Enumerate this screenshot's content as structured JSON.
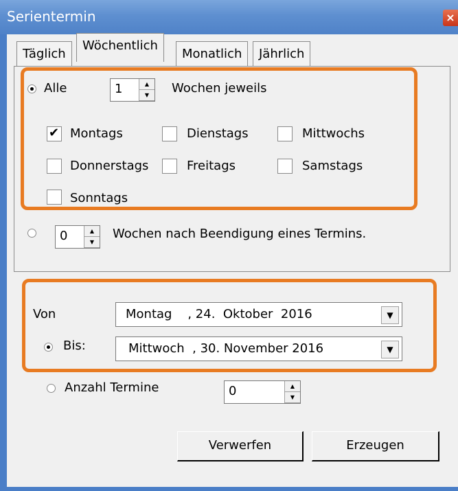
{
  "window": {
    "title": "Serientermin",
    "close_glyph": "×"
  },
  "tabs": [
    {
      "label": "Täglich",
      "active": false
    },
    {
      "label": "Wöchentlich",
      "active": true
    },
    {
      "label": "Monatlich",
      "active": false
    },
    {
      "label": "Jährlich",
      "active": false
    }
  ],
  "weekly": {
    "alle_label": "Alle",
    "interval_value": "1",
    "wochen_jeweils_label": "Wochen jeweils",
    "days": [
      {
        "label": "Montags",
        "checked": true
      },
      {
        "label": "Dienstags",
        "checked": false
      },
      {
        "label": "Mittwochs",
        "checked": false
      },
      {
        "label": "Donnerstags",
        "checked": false
      },
      {
        "label": "Freitags",
        "checked": false
      },
      {
        "label": "Samstags",
        "checked": false
      },
      {
        "label": "Sonntags",
        "checked": false
      }
    ],
    "after_value": "0",
    "after_label": "Wochen nach Beendigung eines Termins."
  },
  "range": {
    "von_label": "Von",
    "von_value": "Montag    , 24.  Oktober  2016",
    "bis_label": "Bis:",
    "bis_value": "Mittwoch  , 30. November 2016",
    "anzahl_label": "Anzahl Termine",
    "anzahl_value": "0"
  },
  "buttons": {
    "discard": "Verwerfen",
    "create": "Erzeugen"
  },
  "colors": {
    "highlight": "#e87b22",
    "titlebar": "#5e8fd0"
  }
}
